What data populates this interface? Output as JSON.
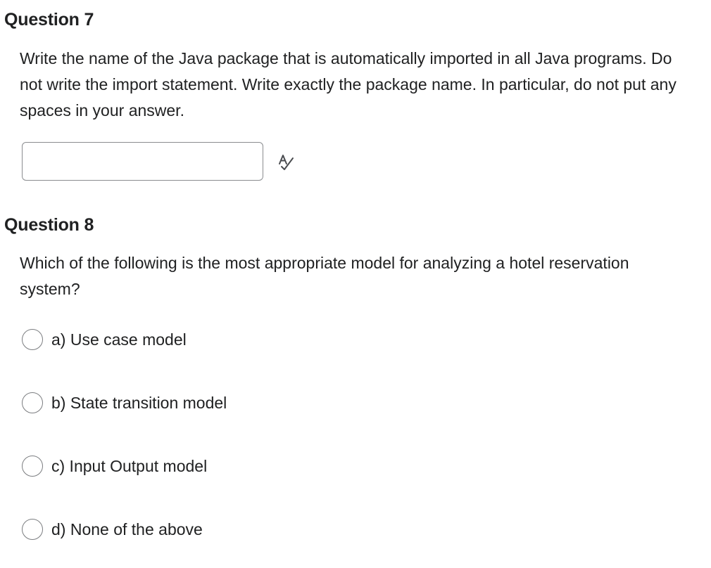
{
  "question7": {
    "title": "Question 7",
    "text": "Write the name of the Java package that is automatically imported in all Java programs. Do not write the import statement. Write exactly the package name. In particular, do not put any spaces in your answer.",
    "answer_value": "",
    "spellcheck_icon": "spellcheck-icon"
  },
  "question8": {
    "title": "Question 8",
    "text": "Which of the following is the most appropriate model for analyzing a hotel reservation system?",
    "options": [
      {
        "label": "a)  Use case model",
        "selected": false
      },
      {
        "label": "b)  State transition model",
        "selected": false
      },
      {
        "label": "c)  Input Output model",
        "selected": false
      },
      {
        "label": "d)  None of the above",
        "selected": false
      }
    ]
  },
  "colors": {
    "text": "#202122",
    "border": "#8a8c8f",
    "background": "#ffffff"
  }
}
